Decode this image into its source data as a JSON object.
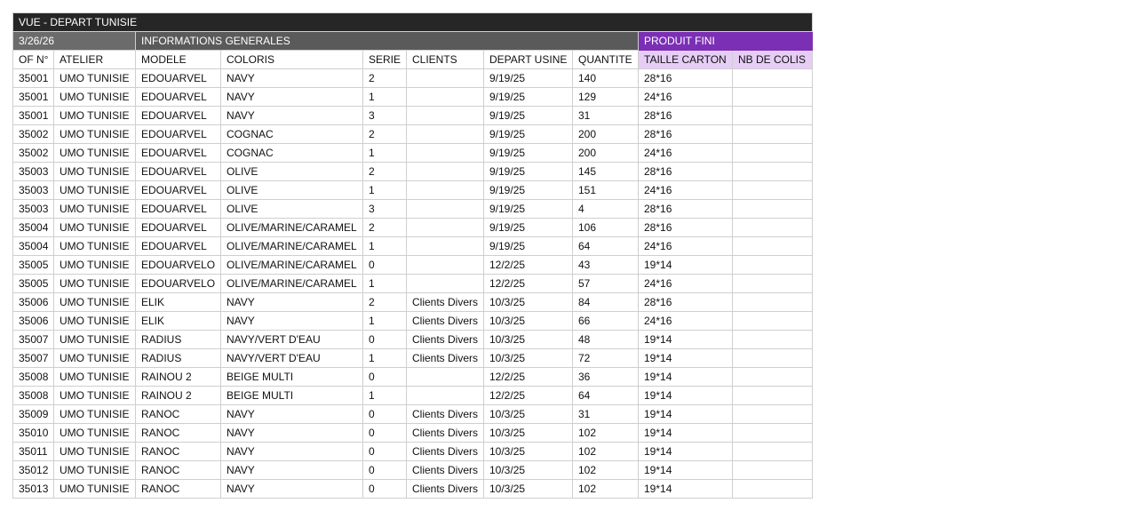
{
  "title": "VUE - DEPART TUNISIE",
  "date": "3/26/26",
  "group_general": "INFORMATIONS GENERALES",
  "group_produit": "PRODUIT FINI",
  "colors": {
    "title_bg": "#262626",
    "group_bg": "#5a5a5a",
    "produit_fini_bg": "#7b2fb5",
    "produit_fini_header_bg": "#e6cdf5"
  },
  "headers": [
    "OF N°",
    "ATELIER",
    "MODELE",
    "COLORIS",
    "SERIE",
    "CLIENTS",
    "DEPART USINE",
    "QUANTITE",
    "TAILLE CARTON",
    "NB DE COLIS"
  ],
  "rows": [
    [
      "35001",
      "UMO TUNISIE",
      "EDOUARVEL",
      "NAVY",
      "2",
      "",
      "9/19/25",
      "140",
      "28*16",
      ""
    ],
    [
      "35001",
      "UMO TUNISIE",
      "EDOUARVEL",
      "NAVY",
      "1",
      "",
      "9/19/25",
      "129",
      "24*16",
      ""
    ],
    [
      "35001",
      "UMO TUNISIE",
      "EDOUARVEL",
      "NAVY",
      "3",
      "",
      "9/19/25",
      "31",
      "28*16",
      ""
    ],
    [
      "35002",
      "UMO TUNISIE",
      "EDOUARVEL",
      "COGNAC",
      "2",
      "",
      "9/19/25",
      "200",
      "28*16",
      ""
    ],
    [
      "35002",
      "UMO TUNISIE",
      "EDOUARVEL",
      "COGNAC",
      "1",
      "",
      "9/19/25",
      "200",
      "24*16",
      ""
    ],
    [
      "35003",
      "UMO TUNISIE",
      "EDOUARVEL",
      "OLIVE",
      "2",
      "",
      "9/19/25",
      "145",
      "28*16",
      ""
    ],
    [
      "35003",
      "UMO TUNISIE",
      "EDOUARVEL",
      "OLIVE",
      "1",
      "",
      "9/19/25",
      "151",
      "24*16",
      ""
    ],
    [
      "35003",
      "UMO TUNISIE",
      "EDOUARVEL",
      "OLIVE",
      "3",
      "",
      "9/19/25",
      "4",
      "28*16",
      ""
    ],
    [
      "35004",
      "UMO TUNISIE",
      "EDOUARVEL",
      "OLIVE/MARINE/CARAMEL",
      "2",
      "",
      "9/19/25",
      "106",
      "28*16",
      ""
    ],
    [
      "35004",
      "UMO TUNISIE",
      "EDOUARVEL",
      "OLIVE/MARINE/CARAMEL",
      "1",
      "",
      "9/19/25",
      "64",
      "24*16",
      ""
    ],
    [
      "35005",
      "UMO TUNISIE",
      "EDOUARVELO",
      "OLIVE/MARINE/CARAMEL",
      "0",
      "",
      "12/2/25",
      "43",
      "19*14",
      ""
    ],
    [
      "35005",
      "UMO TUNISIE",
      "EDOUARVELO",
      "OLIVE/MARINE/CARAMEL",
      "1",
      "",
      "12/2/25",
      "57",
      "24*16",
      ""
    ],
    [
      "35006",
      "UMO TUNISIE",
      "ELIK",
      "NAVY",
      "2",
      "Clients Divers",
      "10/3/25",
      "84",
      "28*16",
      ""
    ],
    [
      "35006",
      "UMO TUNISIE",
      "ELIK",
      "NAVY",
      "1",
      "Clients Divers",
      "10/3/25",
      "66",
      "24*16",
      ""
    ],
    [
      "35007",
      "UMO TUNISIE",
      "RADIUS",
      "NAVY/VERT D'EAU",
      "0",
      "Clients Divers",
      "10/3/25",
      "48",
      "19*14",
      ""
    ],
    [
      "35007",
      "UMO TUNISIE",
      "RADIUS",
      "NAVY/VERT D'EAU",
      "1",
      "Clients Divers",
      "10/3/25",
      "72",
      "19*14",
      ""
    ],
    [
      "35008",
      "UMO TUNISIE",
      "RAINOU 2",
      "BEIGE MULTI",
      "0",
      "",
      "12/2/25",
      "36",
      "19*14",
      ""
    ],
    [
      "35008",
      "UMO TUNISIE",
      "RAINOU 2",
      "BEIGE MULTI",
      "1",
      "",
      "12/2/25",
      "64",
      "19*14",
      ""
    ],
    [
      "35009",
      "UMO TUNISIE",
      "RANOC",
      "NAVY",
      "0",
      "Clients Divers",
      "10/3/25",
      "31",
      "19*14",
      ""
    ],
    [
      "35010",
      "UMO TUNISIE",
      "RANOC",
      "NAVY",
      "0",
      "Clients Divers",
      "10/3/25",
      "102",
      "19*14",
      ""
    ],
    [
      "35011",
      "UMO TUNISIE",
      "RANOC",
      "NAVY",
      "0",
      "Clients Divers",
      "10/3/25",
      "102",
      "19*14",
      ""
    ],
    [
      "35012",
      "UMO TUNISIE",
      "RANOC",
      "NAVY",
      "0",
      "Clients Divers",
      "10/3/25",
      "102",
      "19*14",
      ""
    ],
    [
      "35013",
      "UMO TUNISIE",
      "RANOC",
      "NAVY",
      "0",
      "Clients Divers",
      "10/3/25",
      "102",
      "19*14",
      ""
    ]
  ]
}
